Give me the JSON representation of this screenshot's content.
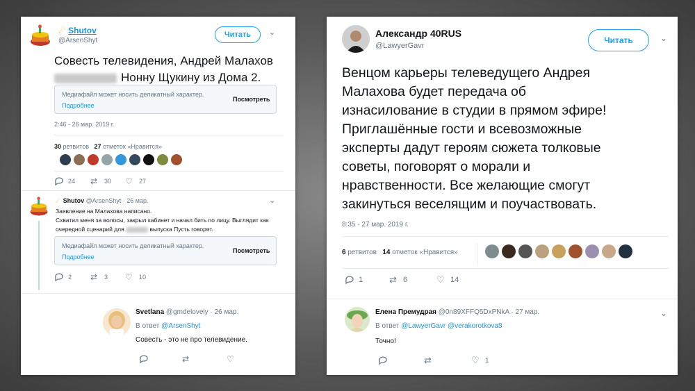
{
  "left": {
    "tweet1": {
      "name": "Shutov",
      "handle": "@ArsenShyt",
      "follow_label": "Читать",
      "text_line1": "Совесть телевидения, Андрей Малахов",
      "text_line2": "Нонну Щукину из Дома 2.",
      "media_notice": "Медиафайл может носить деликатный характер.",
      "media_more": "Подробнее",
      "media_view": "Посмотреть",
      "timestamp": "2:46 - 26 мар. 2019 г.",
      "retweets_count": "30",
      "retweets_label": "ретвитов",
      "likes_count": "27",
      "likes_label": "отметок «Нравится»",
      "reply_count": "24",
      "rt_count": "30",
      "like_count": "27"
    },
    "tweet2": {
      "name": "Shutov",
      "handle_date": "@ArsenShyt · 26 мар.",
      "line1": "Заявление на Малахова написано.",
      "line2": "Схватил меня за волосы, закрыл кабинет и начал бить по лицу. Выглядит как",
      "line3a": "очередной сценарий для",
      "line3b": "выпуска Пусть говорят.",
      "media_notice": "Медиафайл может носить деликатный характер.",
      "media_more": "Подробнее",
      "media_view": "Посмотреть",
      "reply_count": "2",
      "rt_count": "3",
      "like_count": "10"
    },
    "reply": {
      "name": "Svetlana",
      "handle_date": "@gmdelovely · 26 мар.",
      "reply_to_prefix": "В ответ",
      "reply_to_handle": "@ArsenShyt",
      "text": "Совесть - это не про телевидение."
    }
  },
  "right": {
    "tweet": {
      "name": "Александр 40RUS",
      "handle": "@LawyerGavr",
      "follow_label": "Читать",
      "lines": [
        "Венцом карьеры телеведущего Андрея",
        "Малахова будет передача об",
        "изнасилование в студии в прямом эфире!",
        "Приглашённые гости и всевозможные",
        "эксперты дадут героям сюжета толковые",
        "советы, поговорят о морали и",
        "нравственности. Все желающие смогут",
        "закинуться веселящим и поучаствовать."
      ],
      "timestamp": "8:35 - 27 мар. 2019 г.",
      "retweets_count": "6",
      "retweets_label": "ретвитов",
      "likes_count": "14",
      "likes_label": "отметок «Нравится»",
      "reply_count": "1",
      "rt_count": "6",
      "like_count": "14"
    },
    "reply": {
      "name": "Елена Премудрая",
      "handle_date": "@0n89XFFQ5DxPNkA · 27 мар.",
      "reply_to_prefix": "В ответ",
      "reply_to_handles": "@LawyerGavr @verakorotkova8",
      "text": "Точно!",
      "reply_count": "",
      "rt_count": "",
      "like_count": "1"
    }
  },
  "colors": {
    "accent": "#1da1f2",
    "link": "#1b95e0",
    "muted": "#657786",
    "brand_emoji": "#f5a623"
  }
}
